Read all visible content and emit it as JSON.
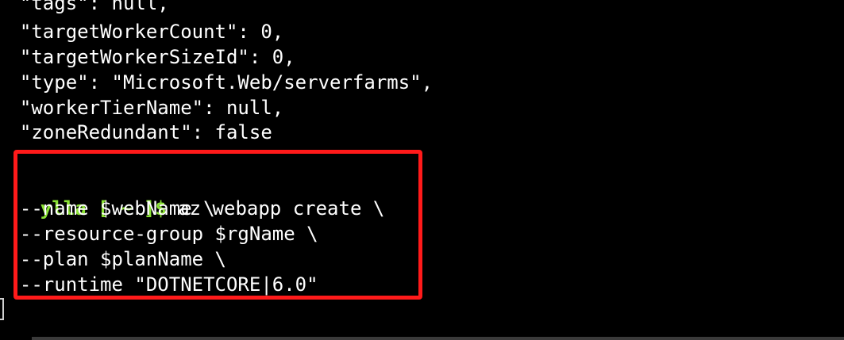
{
  "terminal": {
    "output_lines": [
      "  \"tags\": null,",
      "  \"targetWorkerCount\": 0,",
      "  \"targetWorkerSizeId\": 0,",
      "  \"type\": \"Microsoft.Web/serverfarms\",",
      "  \"workerTierName\": null,",
      "  \"zoneRedundant\": false",
      "}"
    ],
    "prompt": {
      "user": "ylla",
      "path": "[ ~ ]$"
    },
    "command": {
      "first_line": " az webapp create \\",
      "continuation_lines": [
        "  --name $webName \\",
        "  --resource-group $rgName \\",
        "  --plan $planName \\",
        "  --runtime \"DOTNETCORE|6.0\""
      ]
    }
  },
  "colors": {
    "background": "#000000",
    "text": "#ffffff",
    "prompt": "#8ae234",
    "highlight": "#ff1a1a"
  }
}
